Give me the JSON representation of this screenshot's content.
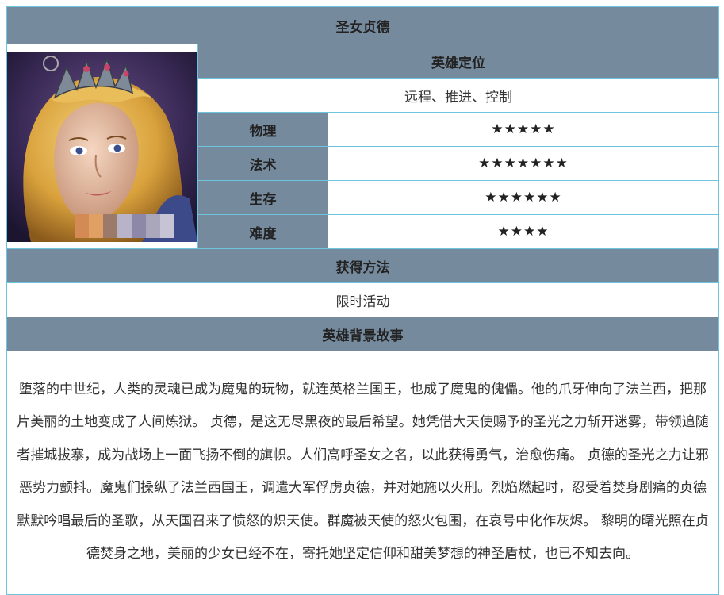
{
  "hero_name": "圣女贞德",
  "role": {
    "header": "英雄定位",
    "value": "远程、推进、控制"
  },
  "stats": [
    {
      "label": "物理",
      "stars": "★★★★★",
      "rating": 5
    },
    {
      "label": "法术",
      "stars": "★★★★★★★",
      "rating": 7
    },
    {
      "label": "生存",
      "stars": "★★★★★★",
      "rating": 6
    },
    {
      "label": "难度",
      "stars": "★★★★",
      "rating": 4
    }
  ],
  "acquire": {
    "header": "获得方法",
    "value": "限时活动"
  },
  "story": {
    "header": "英雄背景故事",
    "text": "堕落的中世纪，人类的灵魂已成为魔鬼的玩物，就连英格兰国王，也成了魔鬼的傀儡。他的爪牙伸向了法兰西，把那片美丽的土地变成了人间炼狱。 贞德，是这无尽黑夜的最后希望。她凭借大天使赐予的圣光之力斩开迷雾，带领追随者摧城拔寨，成为战场上一面飞扬不倒的旗帜。人们高呼圣女之名，以此获得勇气，治愈伤痛。 贞德的圣光之力让邪恶势力颤抖。魔鬼们操纵了法兰西国王，调遣大军俘虏贞德，并对她施以火刑。烈焰燃起时，忍受着焚身剧痛的贞德默默吟唱最后的圣歌，从天国召来了愤怒的炽天使。群魔被天使的怒火包围，在哀号中化作灰烬。 黎明的曙光照在贞德焚身之地，美丽的少女已经不在，寄托她坚定信仰和甜美梦想的神圣盾杖，也已不知去向。"
  },
  "colors": {
    "header_bg": "#768a9d",
    "border": "#6ec4de",
    "cell_bg": "#ffffff"
  }
}
